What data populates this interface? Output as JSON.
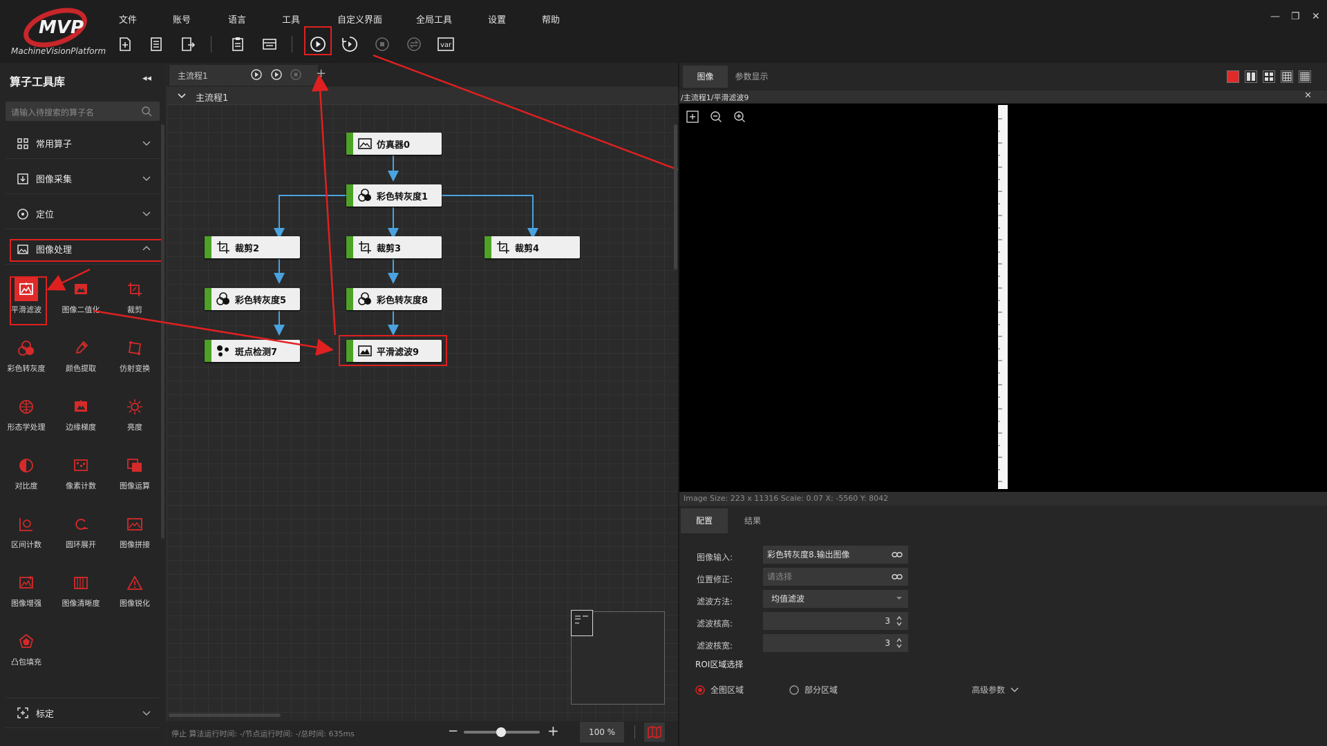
{
  "app": {
    "logo_text": "MachineVisionPlatform"
  },
  "menu": [
    "文件",
    "账号",
    "语言",
    "工具",
    "自定义界面",
    "全局工具",
    "设置",
    "帮助"
  ],
  "toolbar_icons": [
    "new-file-icon",
    "save-icon",
    "save-as-icon",
    "clipboard-icon",
    "layout-icon",
    "run-once-icon",
    "run-loop-icon",
    "stop-icon",
    "switch-icon",
    "variable-icon"
  ],
  "toolbar": {
    "var_label": "var"
  },
  "window_controls": {
    "minimize": "—",
    "restore": "❐",
    "close": "✕"
  },
  "library": {
    "title": "算子工具库",
    "collapse_glyph": "◂◂",
    "search_placeholder": "请输入待搜索的算子名",
    "categories": [
      {
        "label": "常用算子",
        "icon": "grid-icon"
      },
      {
        "label": "图像采集",
        "icon": "capture-icon"
      },
      {
        "label": "定位",
        "icon": "locate-icon"
      },
      {
        "label": "图像处理",
        "icon": "image-icon"
      }
    ],
    "tools": [
      {
        "label": "平滑滤波",
        "icon": "smooth-filter-icon"
      },
      {
        "label": "图像二值化",
        "icon": "binarize-icon"
      },
      {
        "label": "裁剪",
        "icon": "crop-icon"
      },
      {
        "label": "彩色转灰度",
        "icon": "color-to-gray-icon"
      },
      {
        "label": "颜色提取",
        "icon": "color-extract-icon"
      },
      {
        "label": "仿射变换",
        "icon": "affine-icon"
      },
      {
        "label": "形态学处理",
        "icon": "morphology-icon"
      },
      {
        "label": "边缘梯度",
        "icon": "edge-gradient-icon"
      },
      {
        "label": "亮度",
        "icon": "brightness-icon"
      },
      {
        "label": "对比度",
        "icon": "contrast-icon"
      },
      {
        "label": "像素计数",
        "icon": "pixel-count-icon"
      },
      {
        "label": "图像运算",
        "icon": "image-calc-icon"
      },
      {
        "label": "区间计数",
        "icon": "range-count-icon"
      },
      {
        "label": "圆环展开",
        "icon": "ring-unwrap-icon"
      },
      {
        "label": "图像拼接",
        "icon": "stitch-icon"
      },
      {
        "label": "图像增强",
        "icon": "enhance-icon"
      },
      {
        "label": "图像清晰度",
        "icon": "sharpness-icon"
      },
      {
        "label": "图像锐化",
        "icon": "sharpen-icon"
      },
      {
        "label": "凸包填充",
        "icon": "convex-fill-icon"
      }
    ],
    "bottom_category": {
      "label": "标定",
      "icon": "calibrate-icon"
    }
  },
  "flow": {
    "tab_label": "主流程1",
    "header_label": "主流程1",
    "add_tab": "+",
    "nodes": [
      {
        "label": "仿真器0",
        "icon": "image-icon"
      },
      {
        "label": "彩色转灰度1",
        "icon": "color-to-gray-icon"
      },
      {
        "label": "裁剪2",
        "icon": "crop-icon"
      },
      {
        "label": "裁剪3",
        "icon": "crop-icon"
      },
      {
        "label": "裁剪4",
        "icon": "crop-icon"
      },
      {
        "label": "彩色转灰度5",
        "icon": "color-to-gray-icon"
      },
      {
        "label": "彩色转灰度8",
        "icon": "color-to-gray-icon"
      },
      {
        "label": "斑点检测7",
        "icon": "blob-icon"
      },
      {
        "label": "平滑滤波9",
        "icon": "smooth-filter-icon"
      }
    ],
    "status": "停止  算法运行时间: -/节点运行时间: -/总时间: 635ms",
    "zoom": "100 %"
  },
  "image_panel": {
    "tabs": [
      "图像",
      "参数显示"
    ],
    "path": "/主流程1/平滑滤波9",
    "close_glyph": "✕",
    "info": "Image Size: 223 x 11316 Scale: 0.07 X: -5560 Y: 8042"
  },
  "config": {
    "tabs": [
      "配置",
      "结果"
    ],
    "fields": [
      {
        "label": "图像输入:",
        "value": "彩色转灰度8.输出图像",
        "placeholder": ""
      },
      {
        "label": "位置修正:",
        "value": "",
        "placeholder": "请选择"
      },
      {
        "label": "滤波方法:",
        "value": "均值滤波",
        "placeholder": ""
      },
      {
        "label": "滤波核高:",
        "value": "3",
        "placeholder": ""
      },
      {
        "label": "滤波核宽:",
        "value": "3",
        "placeholder": ""
      }
    ],
    "roi_label": "ROI区域选择",
    "roi_options": [
      "全图区域",
      "部分区域"
    ],
    "advanced": "高级参数"
  },
  "colors": {
    "accent": "#e02020",
    "node_green": "#4da126",
    "link_blue": "#4aa3e0"
  }
}
